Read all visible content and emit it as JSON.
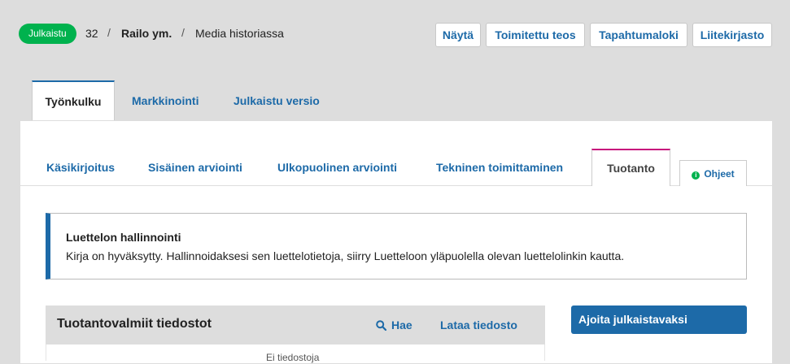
{
  "header": {
    "status_badge": "Julkaistu",
    "submission_id": "32",
    "separator": "/",
    "authors": "Railo ym.",
    "title": "Media historiassa",
    "buttons": {
      "view": "Näytä",
      "edited_volume": "Toimitettu teos",
      "activity_log": "Tapahtumaloki",
      "library": "Liitekirjasto"
    }
  },
  "main_tabs": [
    "Työnkulku",
    "Markkinointi",
    "Julkaistu versio"
  ],
  "stage_tabs": [
    "Käsikirjoitus",
    "Sisäinen arviointi",
    "Ulkopuolinen arviointi",
    "Tekninen toimittaminen",
    "Tuotanto"
  ],
  "help_label": "Ohjeet",
  "notice": {
    "title": "Luettelon hallinnointi",
    "text": "Kirja on hyväksytty. Hallinnoidaksesi sen luettelotietoja, siirry Luetteloon yläpuolella olevan luettelolinkin kautta."
  },
  "files_grid": {
    "title": "Tuotantovalmiit tiedostot",
    "search_label": "Hae",
    "upload_label": "Lataa tiedosto",
    "empty_text": "Ei tiedostoja"
  },
  "schedule_button": "Ajoita julkaistavaksi",
  "colors": {
    "badge_green": "#00b24e",
    "link_blue": "#1d6aa8",
    "production_tab_accent": "#c7117c"
  }
}
